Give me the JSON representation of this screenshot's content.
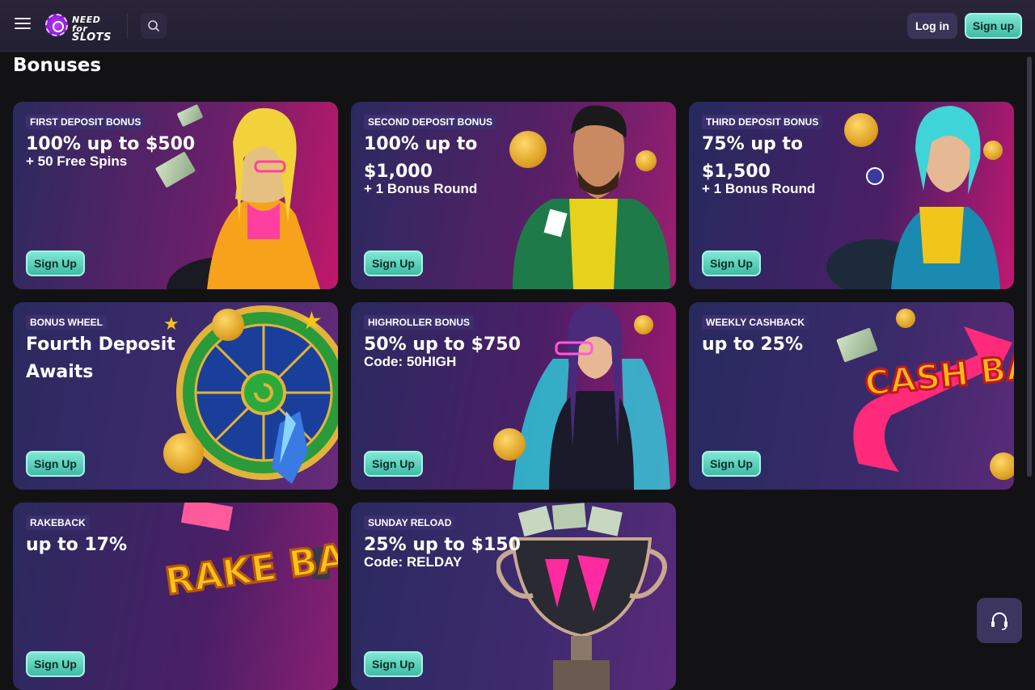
{
  "header": {
    "menu_icon": "hamburger-icon",
    "logo": {
      "line1": "NEED for",
      "line2": "SLOTS"
    },
    "search_icon": "search-icon",
    "login_label": "Log in",
    "signup_label": "Sign up"
  },
  "page": {
    "title": "Bonuses"
  },
  "cards": [
    {
      "tag": "FIRST DEPOSIT BONUS",
      "headline": "100% up to  $500",
      "sub": "+ 50 Free Spins",
      "button": "Sign Up"
    },
    {
      "tag": "SECOND DEPOSIT BONUS",
      "headline": "100% up to $1,000",
      "sub": "+ 1 Bonus Round",
      "button": "Sign Up"
    },
    {
      "tag": "THIRD DEPOSIT BONUS",
      "headline": "75% up to $1,500",
      "sub": "+ 1 Bonus Round",
      "button": "Sign Up"
    },
    {
      "tag": "BONUS WHEEL",
      "headline": "Fourth Deposit Awaits",
      "sub": "",
      "button": "Sign Up"
    },
    {
      "tag": "HIGHROLLER BONUS",
      "headline": "50% up to $750",
      "sub": "Code: 50HIGH",
      "button": "Sign Up"
    },
    {
      "tag": "WEEKLY CASHBACK",
      "headline": "up to 25%",
      "sub": "",
      "button": "Sign Up"
    },
    {
      "tag": "RAKEBACK",
      "headline": "up to 17%",
      "sub": "",
      "button": "Sign Up",
      "art_text": "RAKE BACK"
    },
    {
      "tag": "SUNDAY RELOAD",
      "headline": "25% up to $150",
      "sub": "Code: RELDAY",
      "button": "Sign Up"
    }
  ],
  "cashback_art_text": "CASH BACK",
  "support_icon": "headset-icon"
}
